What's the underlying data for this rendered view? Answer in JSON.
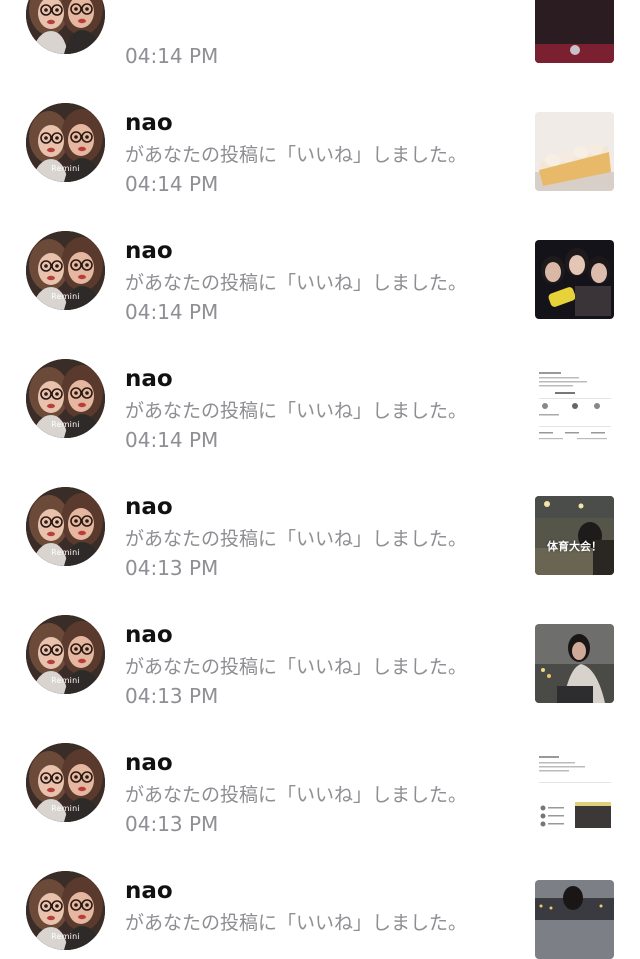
{
  "notifications": [
    {
      "username": "",
      "message": "",
      "time": "04:14 PM",
      "avatar_label": "",
      "thumb_type": "dark-strip",
      "thumb_caption": ""
    },
    {
      "username": "nao",
      "message": "があなたの投稿に「いいね」しました。",
      "time": "04:14 PM",
      "avatar_label": "Remini",
      "thumb_type": "cake",
      "thumb_caption": ""
    },
    {
      "username": "nao",
      "message": "があなたの投稿に「いいね」しました。",
      "time": "04:14 PM",
      "avatar_label": "Remini",
      "thumb_type": "group-photo",
      "thumb_caption": ""
    },
    {
      "username": "nao",
      "message": "があなたの投稿に「いいね」しました。",
      "time": "04:14 PM",
      "avatar_label": "Remini",
      "thumb_type": "screenshot",
      "thumb_caption": ""
    },
    {
      "username": "nao",
      "message": "があなたの投稿に「いいね」しました。",
      "time": "04:13 PM",
      "avatar_label": "Remini",
      "thumb_type": "night-event",
      "thumb_caption": "体育大会！"
    },
    {
      "username": "nao",
      "message": "があなたの投稿に「いいね」しました。",
      "time": "04:13 PM",
      "avatar_label": "Remini",
      "thumb_type": "portrait-night",
      "thumb_caption": ""
    },
    {
      "username": "nao",
      "message": "があなたの投稿に「いいね」しました。",
      "time": "04:13 PM",
      "avatar_label": "Remini",
      "thumb_type": "screenshot-2",
      "thumb_caption": ""
    },
    {
      "username": "nao",
      "message": "があなたの投稿に「いいね」しました。",
      "time": "",
      "avatar_label": "Remini",
      "thumb_type": "cityscape",
      "thumb_caption": ""
    }
  ]
}
